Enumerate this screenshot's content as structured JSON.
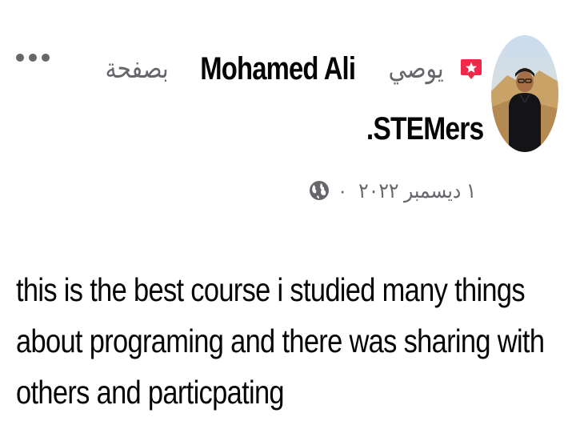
{
  "post": {
    "author_name": "Mohamed Ali",
    "recommend_verb": "يوصي",
    "page_prefix": "بصفحة",
    "page_name": ".STEMers",
    "date": "١ ديسمبر ٢٠٢٢",
    "separator": "·",
    "body_line1": "this is the best course i studied many things",
    "body_line2": "about programing and there was sharing with",
    "body_line3": "others and particpating"
  },
  "icons": {
    "badge": "recommend-star-icon",
    "privacy": "globe-icon",
    "menu": "more-options-icon"
  },
  "colors": {
    "badge_red": "#f02849",
    "secondary_text": "#65676b",
    "primary_text": "#050505"
  }
}
